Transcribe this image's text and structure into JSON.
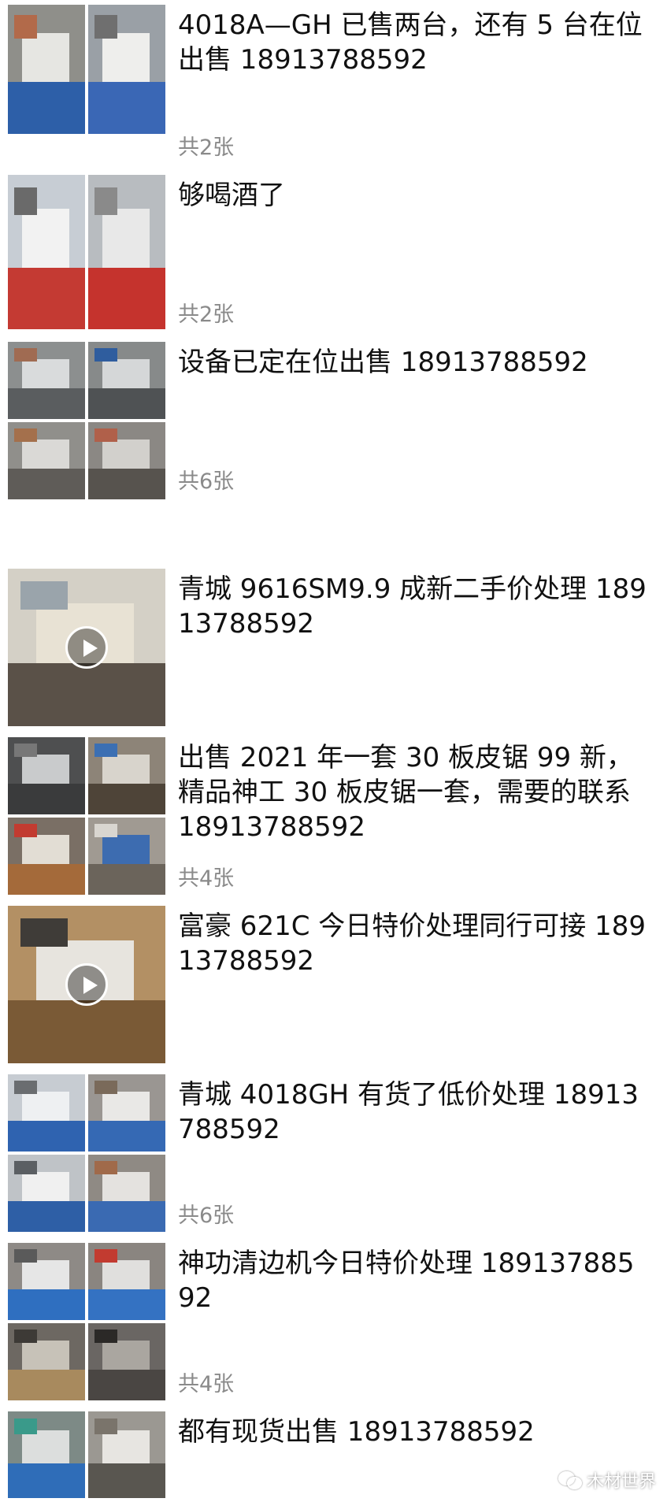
{
  "posts": [
    {
      "text": "4018A—GH 已售两台，还有 5 台在位出售 18913788592",
      "count": "共2张",
      "media": "photos",
      "thumbs": [
        {
          "bg": "#8f8f8a",
          "a": "#2d5fa8",
          "b": "#e6e6e2",
          "c": "#b26a4a"
        },
        {
          "bg": "#9aa0a6",
          "a": "#3a67b5",
          "b": "#eeeeec",
          "c": "#6f6f6f"
        }
      ]
    },
    {
      "text": "够喝酒了",
      "count": "共2张",
      "media": "photos",
      "thumbs": [
        {
          "bg": "#c7cdd4",
          "a": "#c43a33",
          "b": "#f2f2f2",
          "c": "#6a6a6a"
        },
        {
          "bg": "#b8bcc0",
          "a": "#c5332d",
          "b": "#e8e8e8",
          "c": "#8a8a8a"
        }
      ]
    },
    {
      "text": "设备已定在位出售 18913788592",
      "count": "共6张",
      "media": "photos",
      "thumbs": [
        {
          "bg": "#8c8f8f",
          "a": "#5a5d5f",
          "b": "#d9dbdc",
          "c": "#a06b52"
        },
        {
          "bg": "#878a8a",
          "a": "#4f5254",
          "b": "#d5d7d8",
          "c": "#2f5d9e"
        },
        {
          "bg": "#908f8b",
          "a": "#5f5c58",
          "b": "#dad9d6",
          "c": "#a4704c"
        },
        {
          "bg": "#8b8884",
          "a": "#57534e",
          "b": "#d2d0cc",
          "c": "#b0604a"
        }
      ]
    },
    {
      "text": "青城 9616SM9.9 成新二手价处理 18913788592",
      "count": "",
      "media": "video",
      "thumbs": [
        {
          "bg": "#d4d0c6",
          "a": "#5a5148",
          "b": "#e8e2d4",
          "c": "#9aa4ab"
        }
      ]
    },
    {
      "text": "出售 2021 年一套 30 板皮锯 99 新，精品神工 30 板皮锯一套，需要的联系 18913788592",
      "count": "共4张",
      "media": "photos",
      "thumbs": [
        {
          "bg": "#4e4f50",
          "a": "#3a3b3c",
          "b": "#c9cbcc",
          "c": "#777777"
        },
        {
          "bg": "#8d8478",
          "a": "#4e4438",
          "b": "#d8d4cc",
          "c": "#3b6fb3"
        },
        {
          "bg": "#7a6f65",
          "a": "#a46a3a",
          "b": "#e2ddd4",
          "c": "#c23b30"
        },
        {
          "bg": "#a09a92",
          "a": "#6b645b",
          "b": "#3d6cb0",
          "c": "#d9d6d0"
        }
      ]
    },
    {
      "text": "富豪 621C 今日特价处理同行可接 18913788592",
      "count": "",
      "media": "video",
      "thumbs": [
        {
          "bg": "#b39064",
          "a": "#7a5a36",
          "b": "#e7e4de",
          "c": "#3f3c38"
        }
      ]
    },
    {
      "text": "青城 4018GH 有货了低价处理 18913788592",
      "count": "共6张",
      "media": "photos",
      "thumbs": [
        {
          "bg": "#c7ccd2",
          "a": "#2f63b0",
          "b": "#eef0f2",
          "c": "#6a6d70"
        },
        {
          "bg": "#9a9692",
          "a": "#3569b4",
          "b": "#e9e8e6",
          "c": "#7a6a5a"
        },
        {
          "bg": "#bfc3c7",
          "a": "#2e5fa6",
          "b": "#f0f0f0",
          "c": "#5b5f63"
        },
        {
          "bg": "#8f8a84",
          "a": "#3a6ab2",
          "b": "#e4e2df",
          "c": "#a06a4a"
        }
      ]
    },
    {
      "text": "神功清边机今日特价处理 18913788592",
      "count": "共4张",
      "media": "photos",
      "thumbs": [
        {
          "bg": "#8e8a86",
          "a": "#2f6fc0",
          "b": "#e6e6e6",
          "c": "#5a5a5a"
        },
        {
          "bg": "#8a8580",
          "a": "#3472c2",
          "b": "#e0dfdd",
          "c": "#c23b30"
        },
        {
          "bg": "#6d6862",
          "a": "#a88a5e",
          "b": "#c7c2b8",
          "c": "#3d3a36"
        },
        {
          "bg": "#6a6663",
          "a": "#4a4643",
          "b": "#aaa6a0",
          "c": "#2b2927"
        }
      ]
    },
    {
      "text": "都有现货出售 18913788592",
      "count": "",
      "media": "photos",
      "thumbs": [
        {
          "bg": "#7d8a86",
          "a": "#2f6db8",
          "b": "#dcdedd",
          "c": "#3a9a8a"
        },
        {
          "bg": "#9b9892",
          "a": "#595650",
          "b": "#e7e5e1",
          "c": "#7a746b"
        }
      ]
    }
  ],
  "watermark": {
    "icon": "wechat-icon",
    "label": "木材世界"
  }
}
